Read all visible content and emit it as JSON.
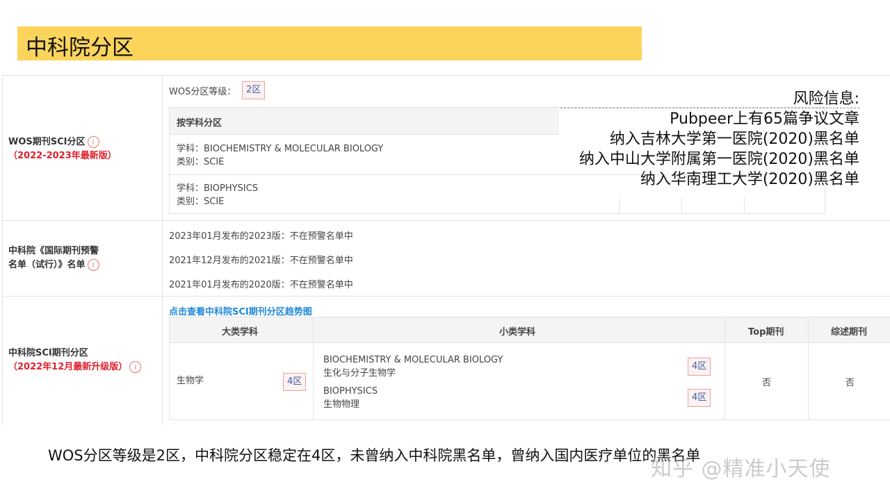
{
  "banner": {
    "title": "中科院分区"
  },
  "wos": {
    "label_line1": "WOS期刊SCI分区",
    "label_line2": "（2022-2023年最新版）",
    "level_label": "WOS分区等级：",
    "level_badge": "2区",
    "table_header": "按学科分区",
    "subjects": [
      {
        "subject": "学科：BIOCHEMISTRY & MOLECULAR BIOLOGY",
        "category": "类别：SCIE"
      },
      {
        "subject": "学科：BIOPHYSICS",
        "category": "类别：SCIE"
      }
    ]
  },
  "risk": {
    "title": "风险信息:",
    "items": [
      "Pubpeer上有65篇争议文章",
      "纳入吉林大学第一医院(2020)黑名单",
      "纳入中山大学附属第一医院(2020)黑名单",
      "纳入华南理工大学(2020)黑名单"
    ]
  },
  "warning": {
    "label_line1": "中科院《国际期刊预警",
    "label_line2": "名单（试行）》名单",
    "entries": [
      "2023年01月发布的2023版：不在预警名单中",
      "2021年12月发布的2021版：不在预警名单中",
      "2021年01月发布的2020版：不在预警名单中"
    ]
  },
  "cas": {
    "label_line1": "中科院SCI期刊分区",
    "label_line2": "（2022年12月最新升级版）",
    "trend_link": "点击查看中科院SCI期刊分区趋势图",
    "headers": {
      "major": "大类学科",
      "minor": "小类学科",
      "top": "Top期刊",
      "review": "综述期刊"
    },
    "major_subject": "生物学",
    "major_badge": "4区",
    "minor_subjects": [
      {
        "en": "BIOCHEMISTRY & MOLECULAR BIOLOGY",
        "zh": "生化与分子生物学",
        "badge": "4区"
      },
      {
        "en": "BIOPHYSICS",
        "zh": "生物物理",
        "badge": "4区"
      }
    ],
    "top_value": "否",
    "review_value": "否"
  },
  "info_icon_glyph": "i",
  "caption": "WOS分区等级是2区，中科院分区稳定在4区，未曾纳入中科院黑名单，曾纳入国内医疗单位的黑名单",
  "watermark": "知乎 @精准小天使"
}
